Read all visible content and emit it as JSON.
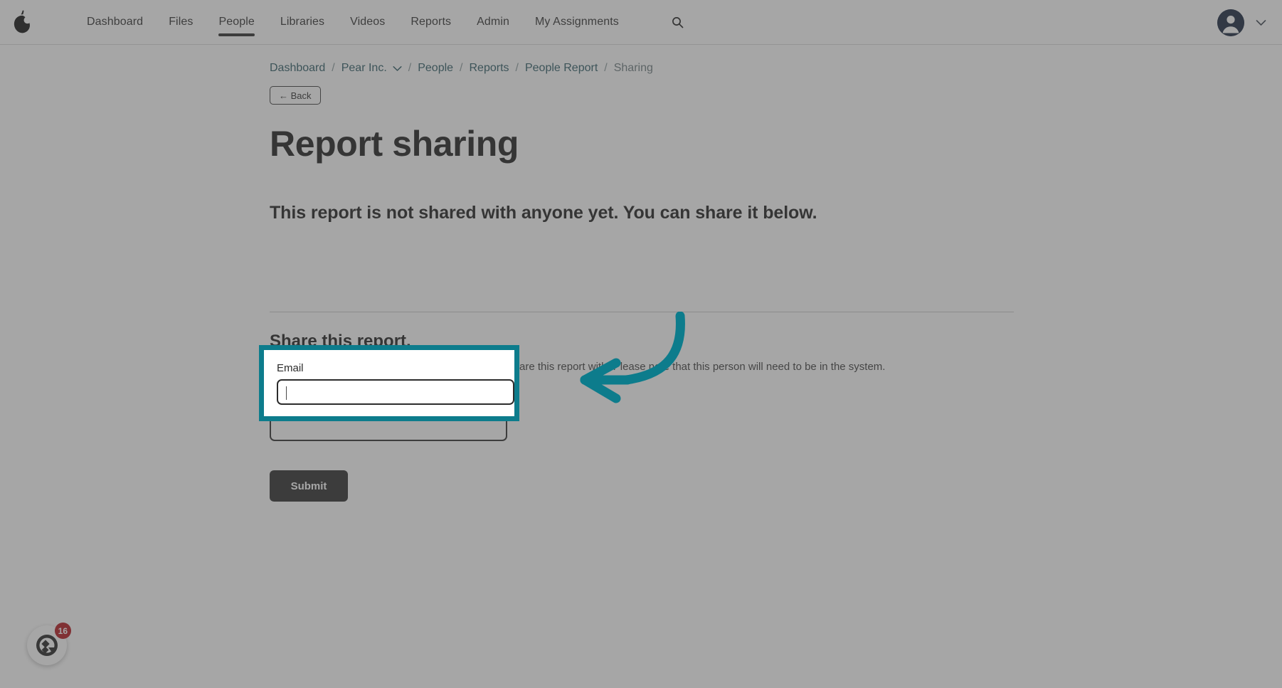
{
  "topnav": {
    "logo_icon": "pear-logo-icon",
    "links": [
      {
        "label": "Dashboard",
        "active": false
      },
      {
        "label": "Files",
        "active": false
      },
      {
        "label": "People",
        "active": true
      },
      {
        "label": "Libraries",
        "active": false
      },
      {
        "label": "Videos",
        "active": false
      },
      {
        "label": "Reports",
        "active": false
      },
      {
        "label": "Admin",
        "active": false
      },
      {
        "label": "My Assignments",
        "active": false
      }
    ],
    "search_icon": "search-icon",
    "avatar_icon": "user-avatar-icon",
    "avatar_chevron_icon": "chevron-down-icon"
  },
  "breadcrumb": {
    "items": [
      {
        "label": "Dashboard",
        "current": false,
        "caret": false
      },
      {
        "label": "Pear Inc.",
        "current": false,
        "caret": true
      },
      {
        "label": "People",
        "current": false,
        "caret": false
      },
      {
        "label": "Reports",
        "current": false,
        "caret": false
      },
      {
        "label": "People Report",
        "current": false,
        "caret": false
      },
      {
        "label": "Sharing",
        "current": true,
        "caret": false
      }
    ],
    "separator": "/"
  },
  "page": {
    "back_label": "← Back",
    "title": "Report sharing",
    "share_status": "This report is not shared with anyone yet. You can share it below."
  },
  "share_section": {
    "heading": "Share this report.",
    "description": "Enter the email address of the person you want to share this report with. Please note that this person will need to be in the system.",
    "email_label": "Email",
    "email_value": "",
    "email_placeholder": "",
    "submit_label": "Submit"
  },
  "annotation": {
    "arrow_icon": "curved-arrow-left-icon",
    "highlight_color": "#0d7c8c",
    "arrow_color": "#0d7c8c",
    "target": "email-input"
  },
  "help_widget": {
    "icon": "help-chat-icon",
    "badge_count": "16"
  },
  "colors": {
    "accent_teal": "#0d7c8c",
    "link_teal": "#2c5a64",
    "dark_button": "#2b2b2b",
    "badge_red": "#b3151b",
    "avatar_navy": "#16243c"
  }
}
